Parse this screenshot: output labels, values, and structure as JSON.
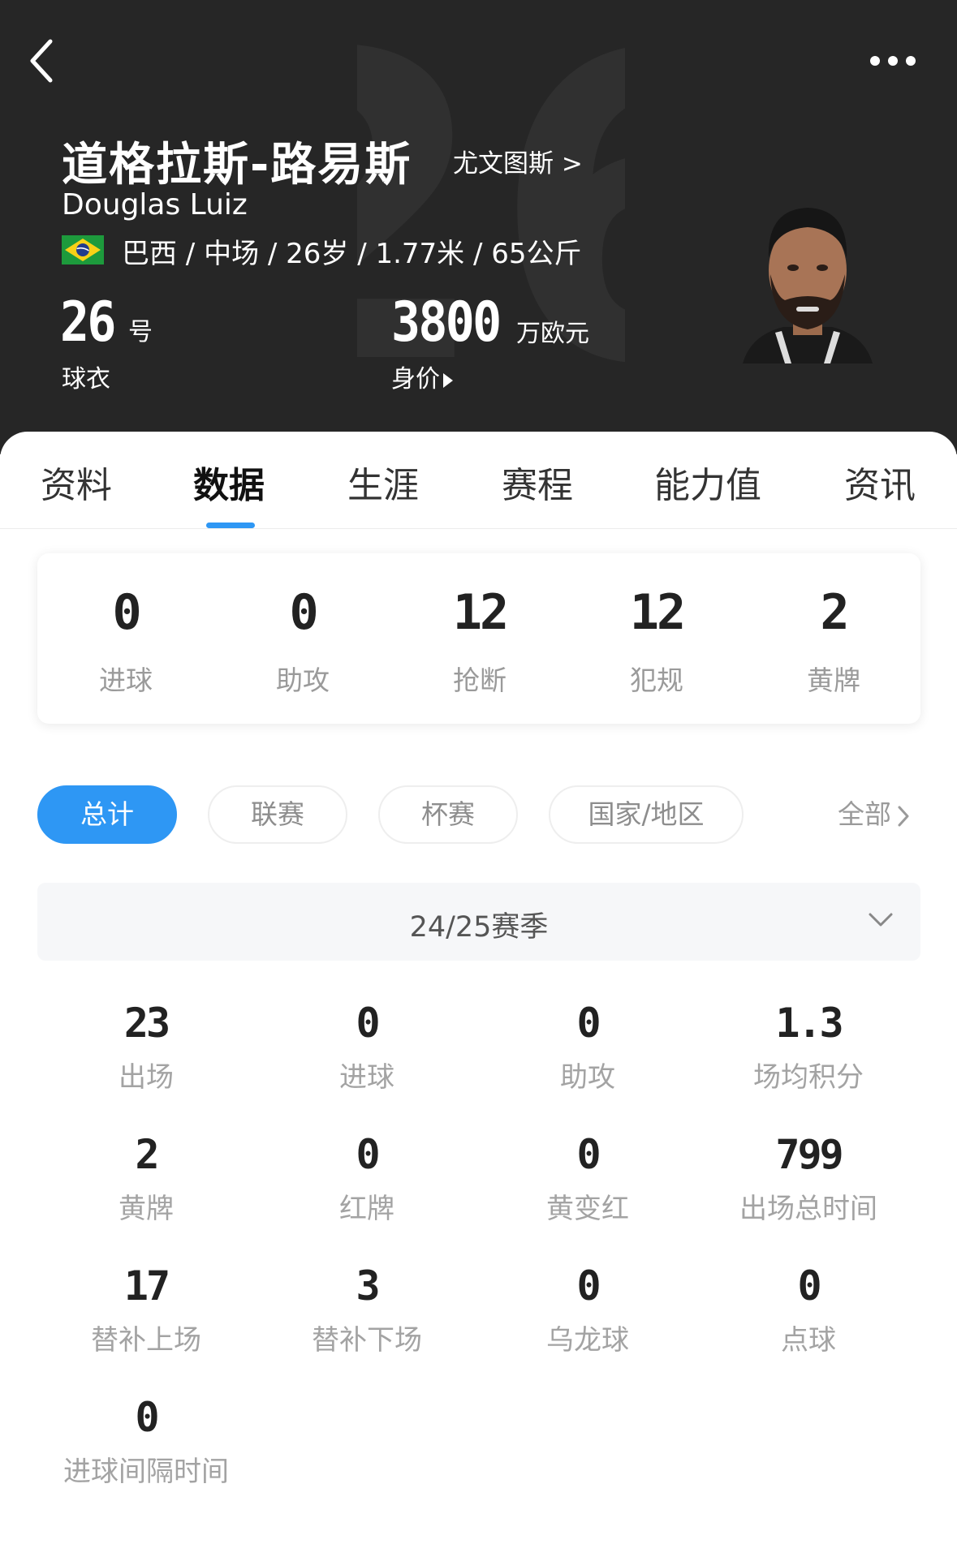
{
  "header": {
    "jersey_number_watermark": "26",
    "name_cn": "道格拉斯-路易斯",
    "club_link": "尤文图斯 >",
    "name_en": "Douglas Luiz",
    "flag_icon": "brazil-flag-icon",
    "info": "巴西 / 中场 / 26岁 / 1.77米 / 65公斤",
    "shirt_number": "26",
    "shirt_number_unit": "号",
    "shirt_number_label": "球衣",
    "market_value": "3800",
    "market_value_unit": "万欧元",
    "market_value_label": "身价"
  },
  "tabs": [
    {
      "label": "资料"
    },
    {
      "label": "数据"
    },
    {
      "label": "生涯"
    },
    {
      "label": "赛程"
    },
    {
      "label": "能力值"
    },
    {
      "label": "资讯"
    }
  ],
  "active_tab": "数据",
  "summary": [
    {
      "value": "0",
      "label": "进球"
    },
    {
      "value": "0",
      "label": "助攻"
    },
    {
      "value": "12",
      "label": "抢断"
    },
    {
      "value": "12",
      "label": "犯规"
    },
    {
      "value": "2",
      "label": "黄牌"
    }
  ],
  "filters": [
    {
      "label": "总计"
    },
    {
      "label": "联赛"
    },
    {
      "label": "杯赛"
    },
    {
      "label": "国家/地区"
    }
  ],
  "all_link": "全部",
  "season": "24/25赛季",
  "stats": [
    {
      "value": "23",
      "label": "出场"
    },
    {
      "value": "0",
      "label": "进球"
    },
    {
      "value": "0",
      "label": "助攻"
    },
    {
      "value": "1.3",
      "label": "场均积分"
    },
    {
      "value": "2",
      "label": "黄牌"
    },
    {
      "value": "0",
      "label": "红牌"
    },
    {
      "value": "0",
      "label": "黄变红"
    },
    {
      "value": "799",
      "label": "出场总时间"
    },
    {
      "value": "17",
      "label": "替补上场"
    },
    {
      "value": "3",
      "label": "替补下场"
    },
    {
      "value": "0",
      "label": "乌龙球"
    },
    {
      "value": "0",
      "label": "点球"
    },
    {
      "value": "0",
      "label": "进球间隔时间"
    }
  ],
  "colors": {
    "header_bg": "#262626",
    "accent": "#2e97f4"
  }
}
